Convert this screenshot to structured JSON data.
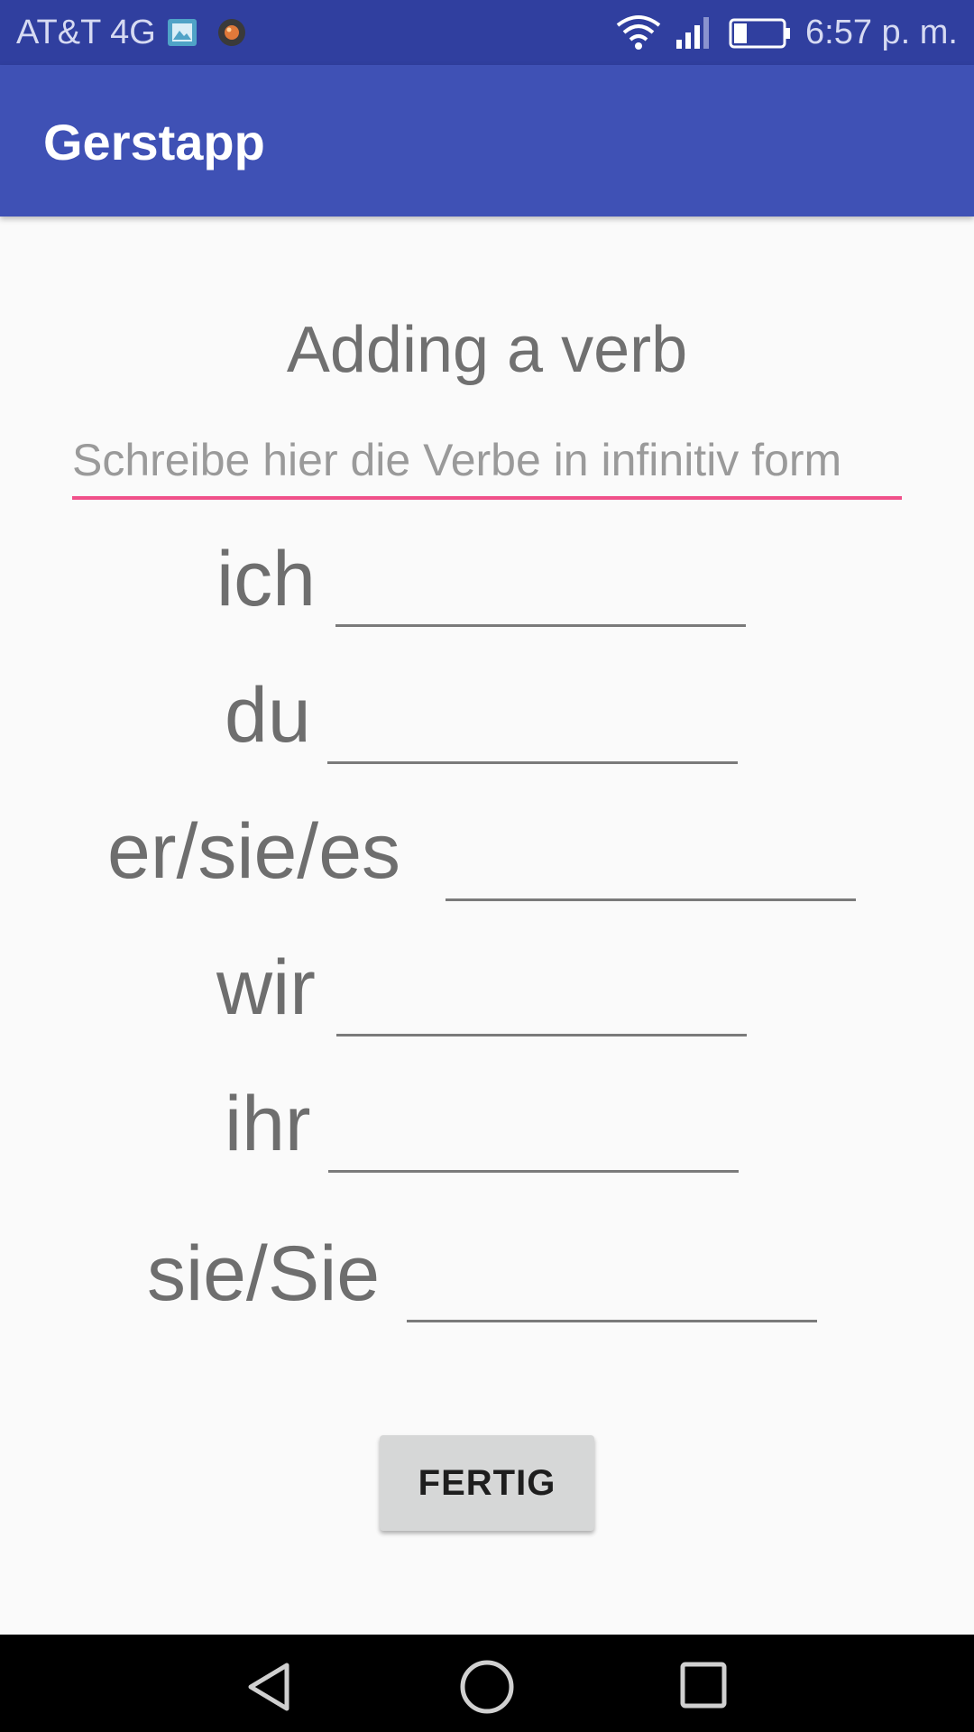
{
  "status_bar": {
    "carrier": "AT&T 4G",
    "time": "6:57 p. m.",
    "icons": [
      "gallery-notification-icon",
      "app-notification-icon",
      "wifi-icon",
      "signal-icon",
      "battery-icon"
    ]
  },
  "app_bar": {
    "title": "Gerstapp",
    "color": "#3f51b5"
  },
  "main": {
    "heading": "Adding a verb",
    "infinitive_input": {
      "placeholder": "Schreibe hier die Verbe in infinitiv form",
      "value": "",
      "accent_color": "#f0508a"
    },
    "conjugations": [
      {
        "pronoun": "ich",
        "value": ""
      },
      {
        "pronoun": "du",
        "value": ""
      },
      {
        "pronoun": "er/sie/es",
        "value": ""
      },
      {
        "pronoun": "wir",
        "value": ""
      },
      {
        "pronoun": "ihr",
        "value": ""
      },
      {
        "pronoun": "sie/Sie",
        "value": ""
      }
    ],
    "submit_label": "FERTIG"
  },
  "nav_bar": {
    "icons": [
      "back-icon",
      "home-icon",
      "recents-icon"
    ]
  }
}
